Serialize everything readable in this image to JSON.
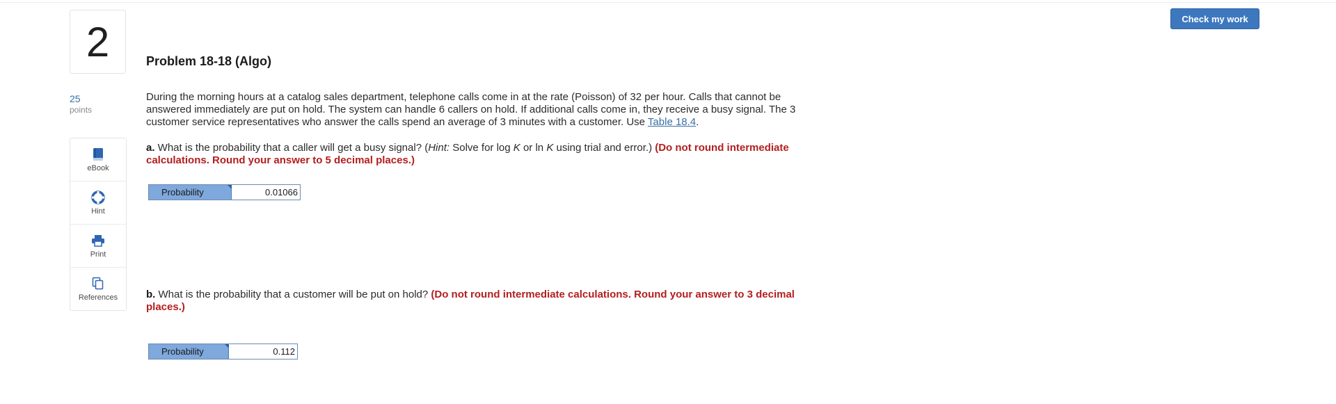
{
  "question": {
    "number": "2",
    "points_value": "25",
    "points_label": "points"
  },
  "tools": [
    {
      "label": "eBook",
      "icon": "book-icon"
    },
    {
      "label": "Hint",
      "icon": "lifebuoy-icon"
    },
    {
      "label": "Print",
      "icon": "printer-icon"
    },
    {
      "label": "References",
      "icon": "copy-icon"
    }
  ],
  "check_button": "Check my work",
  "problem": {
    "title": "Problem 18-18 (Algo)",
    "text": "During the morning hours at a catalog sales department, telephone calls come in at the rate (Poisson) of 32 per hour. Calls that cannot be answered immediately are put on hold. The system can handle 6 callers on hold. If additional calls come in, they receive a busy signal. The 3 customer service representatives who answer the calls spend an average of 3 minutes with a customer. Use ",
    "link_text": "Table 18.4",
    "text_end": "."
  },
  "part_a": {
    "label": "a.",
    "question_pre": " What is the probability that a caller will get a busy signal? (",
    "hint_word": "Hint:",
    "question_mid1": " Solve for log ",
    "var_k1": "K",
    "question_mid2": " or ln ",
    "var_k2": "K",
    "question_mid3": " using trial and error.) ",
    "instruction": "(Do not round intermediate calculations. Round your answer to 5 decimal places.)",
    "answer_label": "Probability",
    "answer_value": "0.01066"
  },
  "part_b": {
    "label": "b.",
    "question": " What is the probability that a customer will be put on hold? ",
    "instruction": "(Do not round intermediate calculations. Round your answer to 3 decimal places.)",
    "answer_label": "Probability",
    "answer_value": "0.112"
  }
}
